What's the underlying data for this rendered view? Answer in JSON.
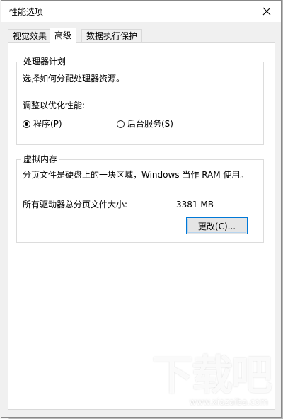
{
  "dialog": {
    "title": "性能选项"
  },
  "tabs": [
    {
      "label": "视觉效果",
      "active": false
    },
    {
      "label": "高级",
      "active": true
    },
    {
      "label": "数据执行保护",
      "active": false
    }
  ],
  "processor": {
    "group_label": "处理器计划",
    "description": "选择如何分配处理器资源。",
    "adjust_label": "调整以优化性能:",
    "options": [
      {
        "label": "程序(P)",
        "checked": true
      },
      {
        "label": "后台服务(S)",
        "checked": false
      }
    ]
  },
  "virtual_memory": {
    "group_label": "虚拟内存",
    "description": "分页文件是硬盘上的一块区域，Windows 当作 RAM 使用。",
    "total_label": "所有驱动器总分页文件大小:",
    "total_value": "3381 MB",
    "change_button": "更改(C)..."
  },
  "watermark": {
    "logo": "下载吧",
    "url": "www.xiazaiba.com"
  },
  "icons": {
    "close": "close-icon"
  }
}
